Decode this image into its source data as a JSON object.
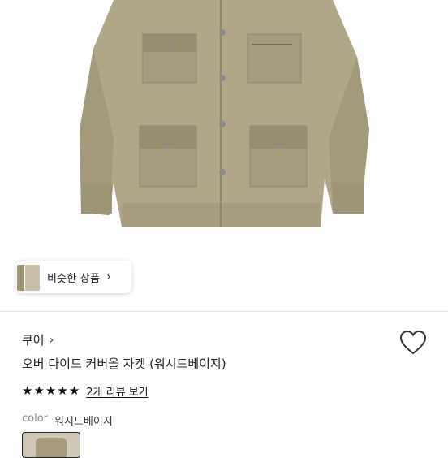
{
  "similar": {
    "label": "비슷한 상품"
  },
  "product": {
    "brand": "쿠어",
    "title": "오버 다이드 커버올 자켓 (워시드베이지)",
    "rating_stars": 5,
    "reviews_label": "2개 리뷰 보기",
    "color_label": "color",
    "color_value": "워시드베이지"
  },
  "colors": {
    "jacket": "#b0a688",
    "jacket_shadow": "#8f866b",
    "button": "#8b8c88"
  }
}
